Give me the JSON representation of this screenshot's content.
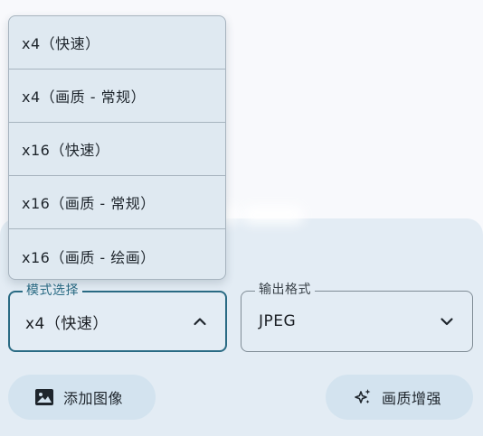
{
  "menu": {
    "items": [
      {
        "label": "x4（快速）"
      },
      {
        "label": "x4（画质 - 常规）"
      },
      {
        "label": "x16（快速）"
      },
      {
        "label": "x16（画质 - 常规）"
      },
      {
        "label": "x16（画质 - 绘画）"
      }
    ]
  },
  "mode_field": {
    "label": "模式选择",
    "value": "x4（快速）",
    "icon": "chevron-up-icon"
  },
  "format_field": {
    "label": "输出格式",
    "value": "JPEG",
    "icon": "chevron-down-icon"
  },
  "buttons": {
    "add_image": {
      "label": "添加图像",
      "icon": "image-icon"
    },
    "enhance": {
      "label": "画质增强",
      "icon": "sparkle-icon"
    }
  },
  "colors": {
    "accent": "#2a6b84",
    "panel_bg": "#e3ecf4",
    "menu_bg": "#dfe9f1",
    "button_bg": "#d3e3ef",
    "page_bg": "#f8f9fc"
  }
}
